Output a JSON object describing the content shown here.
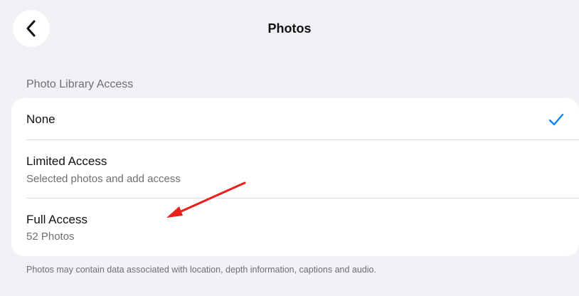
{
  "nav": {
    "title": "Photos",
    "back_icon": "chevron-left-icon"
  },
  "section": {
    "header": "Photo Library Access",
    "footer": "Photos may contain data associated with location, depth information, captions and audio."
  },
  "options": [
    {
      "title": "None",
      "subtitle": "",
      "selected": true
    },
    {
      "title": "Limited Access",
      "subtitle": "Selected photos and add access",
      "selected": false
    },
    {
      "title": "Full Access",
      "subtitle": "52 Photos",
      "selected": false
    }
  ],
  "colors": {
    "background": "#f2f2f6",
    "card": "#ffffff",
    "accent": "#0a84ff",
    "annotation_arrow": "#e8211d"
  },
  "icons": {
    "selected": "checkmark-icon",
    "annotation": "red-arrow-annotation"
  }
}
